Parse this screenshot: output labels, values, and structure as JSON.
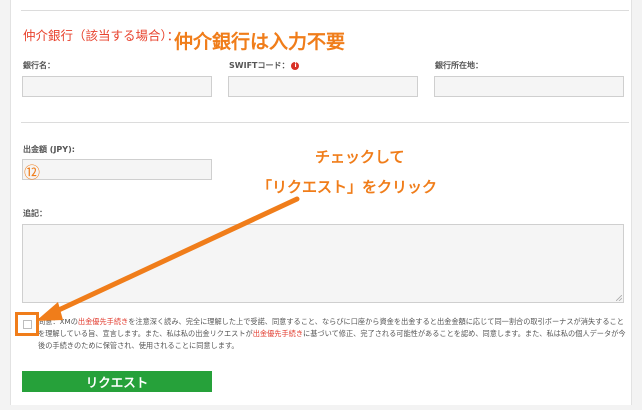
{
  "intermediary": {
    "title": "仲介銀行（該当する場合）：",
    "callout": "仲介銀行は入力不要",
    "fields": [
      {
        "label": "銀行名："
      },
      {
        "label": "SWIFTコード："
      },
      {
        "label": "銀行所在地："
      }
    ]
  },
  "amount": {
    "label": "出金額 (JPY):",
    "step_marker": "⑫"
  },
  "notes": {
    "label": "追記："
  },
  "instruction": {
    "line1": "チェックして",
    "line2": "「リクエスト」をクリック"
  },
  "agreement": {
    "seg1": "同意：XMの",
    "link1": "出金優先手続き",
    "seg2": "を注意深く読み、完全に理解した上で受諾、同意すること、ならびに口座から資金を出金すると出金金額に応じて同一割合の取引ボーナスが消失することを理解している旨、宣言します。また、私は私の出金リクエストが",
    "link2": "出金優先手続き",
    "seg3": "に基づいて修正、完了される可能性があることを認め、同意します。また、私は私の個人データが今後の手続きのために保管され、使用されることに同意します。",
    "checked": false
  },
  "submit": {
    "label": "リクエスト"
  },
  "colors": {
    "accent_red": "#e8432e",
    "annotation_orange": "#f07d1a",
    "button_green": "#26a13a"
  }
}
